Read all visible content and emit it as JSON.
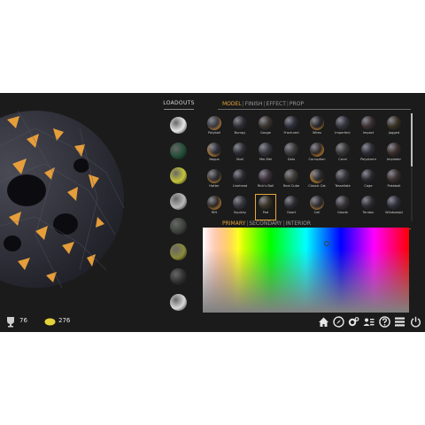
{
  "loadouts": {
    "title": "LOADOUTS",
    "slots": [
      {
        "name": "slot-1",
        "color": "#e6e6e6"
      },
      {
        "name": "slot-2",
        "color": "#1f4b34"
      },
      {
        "name": "slot-3",
        "color": "#c4c43a"
      },
      {
        "name": "slot-4",
        "color": "#b9b9b9"
      },
      {
        "name": "slot-5",
        "color": "#3a3f38"
      },
      {
        "name": "slot-6",
        "color": "#8a8a3a"
      },
      {
        "name": "slot-7",
        "color": "#2c2c2c"
      },
      {
        "name": "slot-8",
        "color": "#d9d9d9"
      }
    ]
  },
  "top_tabs": {
    "items": [
      {
        "label": "MODEL",
        "active": true
      },
      {
        "label": "FINISH",
        "active": false
      },
      {
        "label": "EFFECT",
        "active": false
      },
      {
        "label": "PROP",
        "active": false
      }
    ],
    "separator": "|"
  },
  "models": [
    {
      "label": "Polyball",
      "color": "#3a3a42"
    },
    {
      "label": "Bumpy",
      "color": "#2d2d33"
    },
    {
      "label": "Gouge",
      "color": "#3a342e"
    },
    {
      "label": "Fractured",
      "color": "#2e2e38"
    },
    {
      "label": "Wires",
      "color": "#26262c"
    },
    {
      "label": "Imperfect",
      "color": "#34343c"
    },
    {
      "label": "Impact",
      "color": "#3a3030"
    },
    {
      "label": "Jagged",
      "color": "#3a3324"
    },
    {
      "label": "Nagus",
      "color": "#2e2e36"
    },
    {
      "label": "Skull",
      "color": "#2c2c32"
    },
    {
      "label": "Mei-Mei",
      "color": "#36363e"
    },
    {
      "label": "Dots",
      "color": "#3a3a3a"
    },
    {
      "label": "Corruption",
      "color": "#302a2a"
    },
    {
      "label": "Coral",
      "color": "#363636"
    },
    {
      "label": "Polystorm",
      "color": "#2e2e36"
    },
    {
      "label": "Imploder",
      "color": "#3a2e2a"
    },
    {
      "label": "Hatter",
      "color": "#2e2e30"
    },
    {
      "label": "Linehead",
      "color": "#2a2a2e"
    },
    {
      "label": "Rick's Ball",
      "color": "#3a3038"
    },
    {
      "label": "Real Cube",
      "color": "#3e3a34"
    },
    {
      "label": "Classic Cat",
      "color": "#2e2e2e"
    },
    {
      "label": "Tessellate",
      "color": "#343438"
    },
    {
      "label": "Cage",
      "color": "#2a2a2e"
    },
    {
      "label": "Pokeball",
      "color": "#3a3030"
    },
    {
      "label": "Rift",
      "color": "#2e2a26"
    },
    {
      "label": "Squishy",
      "color": "#34343a"
    },
    {
      "label": "Pod",
      "color": "#3a3426"
    },
    {
      "label": "Geart",
      "color": "#2c2c30"
    },
    {
      "label": "Cell",
      "color": "#2e2e30"
    },
    {
      "label": "Geode",
      "color": "#363236"
    },
    {
      "label": "Tendon",
      "color": "#2e2c30"
    },
    {
      "label": "Windswept",
      "color": "#30303a"
    }
  ],
  "selected_model": "Pod",
  "color_tabs": {
    "items": [
      {
        "label": "PRIMARY",
        "active": true
      },
      {
        "label": "SECONDARY",
        "active": false
      },
      {
        "label": "INTERIOR",
        "active": false
      }
    ],
    "separator": "|"
  },
  "stats": {
    "trophies": "76",
    "coins": "276"
  },
  "bottom_icons": [
    "home-icon",
    "compass-icon",
    "settings-icon",
    "profile-card-icon",
    "help-icon",
    "menu-icon",
    "power-icon"
  ],
  "colors": {
    "accent": "#e8a53b",
    "background": "#1b1b1b",
    "glow": "#f0a43a"
  }
}
